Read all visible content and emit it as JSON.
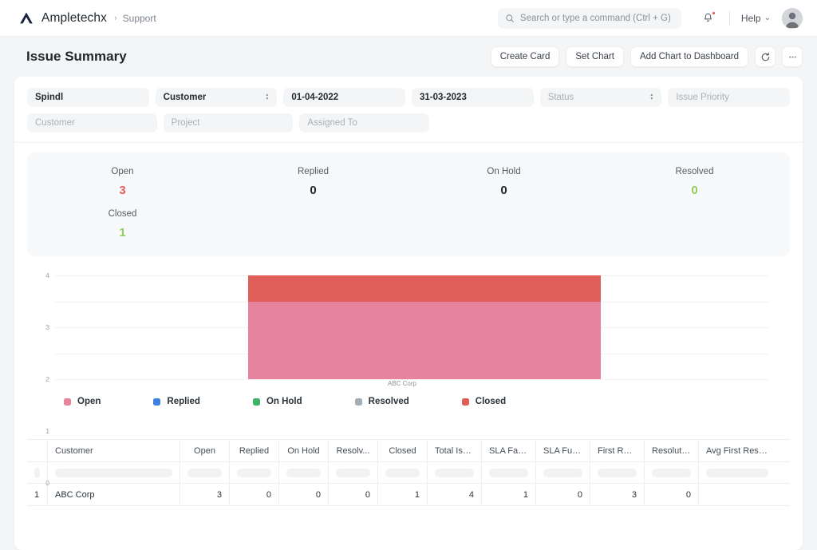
{
  "navbar": {
    "brand": "Ampletechx",
    "breadcrumb_separator": "›",
    "breadcrumb": "Support",
    "search_placeholder": "Search or type a command (Ctrl + G)",
    "search_icon": "search-icon",
    "bell_icon": "notification-bell-icon",
    "help_label": "Help",
    "help_caret": "⌄",
    "avatar": "user-avatar"
  },
  "page": {
    "title": "Issue Summary",
    "actions": [
      {
        "label": "Create Card",
        "name": "create-card-button"
      },
      {
        "label": "Set Chart",
        "name": "set-chart-button"
      },
      {
        "label": "Add Chart to Dashboard",
        "name": "add-chart-to-dashboard-button"
      }
    ],
    "refresh_icon": "refresh-icon",
    "more_icon": "ellipsis-icon"
  },
  "filters": {
    "row1": [
      {
        "value": "Spindl",
        "placeholder": "",
        "type": "text",
        "name": "filter-company"
      },
      {
        "value": "Customer",
        "placeholder": "",
        "type": "select",
        "name": "filter-group-by"
      },
      {
        "value": "01-04-2022",
        "placeholder": "",
        "type": "date",
        "name": "filter-from-date"
      },
      {
        "value": "31-03-2023",
        "placeholder": "",
        "type": "date",
        "name": "filter-to-date"
      },
      {
        "value": "",
        "placeholder": "Status",
        "type": "select",
        "name": "filter-status"
      },
      {
        "value": "",
        "placeholder": "Issue Priority",
        "type": "text",
        "name": "filter-issue-priority"
      }
    ],
    "row2": [
      {
        "value": "",
        "placeholder": "Customer",
        "type": "text",
        "name": "filter-customer"
      },
      {
        "value": "",
        "placeholder": "Project",
        "type": "text",
        "name": "filter-project"
      },
      {
        "value": "",
        "placeholder": "Assigned To",
        "type": "text",
        "name": "filter-assigned-to"
      }
    ]
  },
  "stats": [
    {
      "label": "Open",
      "value": "3",
      "color": "#e05f5a",
      "sub_label": "Closed",
      "sub_value": "1",
      "sub_color": "#8fce59"
    },
    {
      "label": "Replied",
      "value": "0",
      "color": "#1f272e"
    },
    {
      "label": "On Hold",
      "value": "0",
      "color": "#1f272e"
    },
    {
      "label": "Resolved",
      "value": "0",
      "color": "#8fce59"
    }
  ],
  "chart_data": {
    "type": "bar",
    "stacked": true,
    "title": "",
    "xlabel": "",
    "ylabel": "",
    "categories": [
      "ABC Corp"
    ],
    "yticks": [
      0,
      1,
      2,
      3,
      4
    ],
    "ylim": [
      0,
      4
    ],
    "grid": true,
    "legend_position": "bottom",
    "series": [
      {
        "name": "Open",
        "values": [
          3
        ],
        "color": "#e8839e"
      },
      {
        "name": "Replied",
        "values": [
          0
        ],
        "color": "#3e7fe0"
      },
      {
        "name": "On Hold",
        "values": [
          0
        ],
        "color": "#3fb36a"
      },
      {
        "name": "Resolved",
        "values": [
          0
        ],
        "color": "#a3adb6"
      },
      {
        "name": "Closed",
        "values": [
          1
        ],
        "color": "#e05f5a"
      }
    ]
  },
  "table": {
    "columns": [
      {
        "key": "idx",
        "label": "",
        "cls": "idx"
      },
      {
        "key": "customer",
        "label": "Customer",
        "cls": "name"
      },
      {
        "key": "open",
        "label": "Open",
        "cls": "num"
      },
      {
        "key": "replied",
        "label": "Replied",
        "cls": "num"
      },
      {
        "key": "onhold",
        "label": "On Hold",
        "cls": "num"
      },
      {
        "key": "resolved",
        "label": "Resolv...",
        "cls": "num"
      },
      {
        "key": "closed",
        "label": "Closed",
        "cls": "num"
      },
      {
        "key": "total",
        "label": "Total Issues",
        "cls": "wide"
      },
      {
        "key": "slafail",
        "label": "SLA Failed",
        "cls": "wide"
      },
      {
        "key": "slaful",
        "label": "SLA Fulfill...",
        "cls": "wide"
      },
      {
        "key": "firstres",
        "label": "First Resp...",
        "cls": "wide"
      },
      {
        "key": "resol",
        "label": "Resolution...",
        "cls": "wide"
      },
      {
        "key": "avgfirst",
        "label": "Avg First Respons",
        "cls": "last"
      }
    ],
    "rows": [
      {
        "idx": "1",
        "customer": "ABC Corp",
        "open": "3",
        "replied": "0",
        "onhold": "0",
        "resolved": "0",
        "closed": "1",
        "total": "4",
        "slafail": "1",
        "slaful": "0",
        "firstres": "3",
        "resol": "0",
        "avgfirst": ""
      }
    ]
  }
}
